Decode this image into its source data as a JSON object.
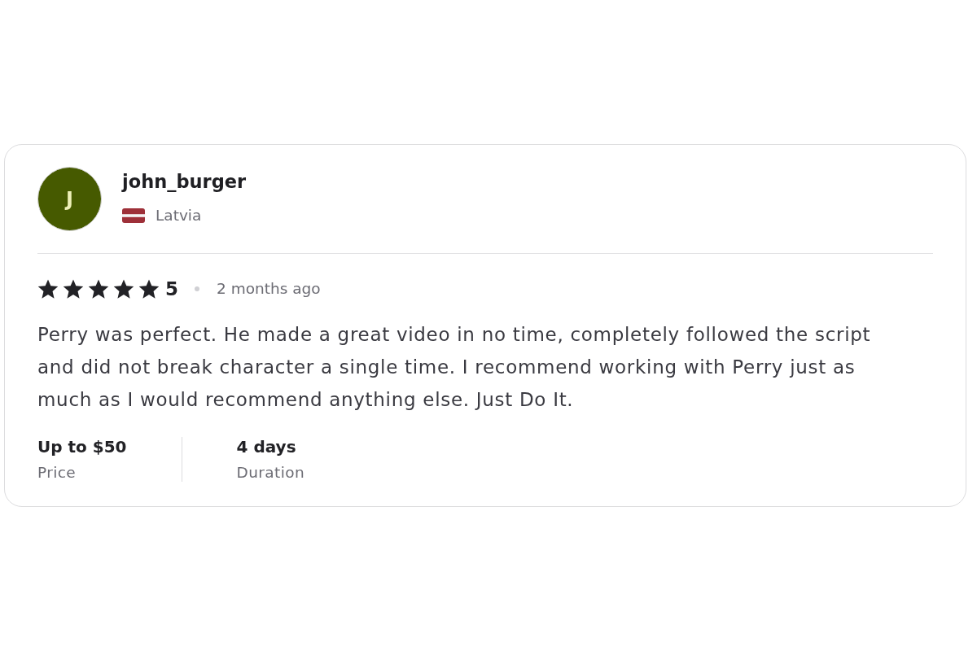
{
  "review": {
    "reviewer": {
      "avatar_initial": "J",
      "name": "john_burger",
      "country": "Latvia"
    },
    "stars": 5,
    "rating": "5",
    "time": "2 months ago",
    "text": "Perry was perfect. He made a great video in no time, completely followed the script and did not break character a single time. I recommend working with Perry just as much as I would recommend anything else. Just Do It.",
    "stats": [
      {
        "value": "Up to $50",
        "label": "Price"
      },
      {
        "value": "4 days",
        "label": "Duration"
      }
    ]
  }
}
